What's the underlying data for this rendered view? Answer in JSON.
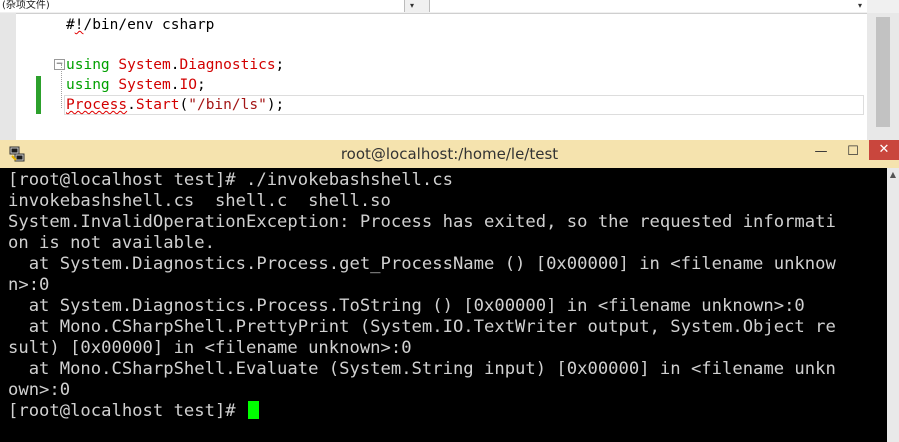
{
  "editor": {
    "nav_left_label": "(杂项文件)",
    "code_lines": [
      {
        "parts": [
          {
            "t": "#",
            "c": ""
          },
          {
            "t": "!",
            "c": "squiggle"
          },
          {
            "t": "/bin/env csharp",
            "c": ""
          }
        ]
      },
      {
        "parts": []
      },
      {
        "parts": [
          {
            "t": "using",
            "c": "kw"
          },
          {
            "t": " ",
            "c": ""
          },
          {
            "t": "System",
            "c": "ns"
          },
          {
            "t": ".",
            "c": ""
          },
          {
            "t": "Diagnostics",
            "c": "ns"
          },
          {
            "t": ";",
            "c": ""
          }
        ]
      },
      {
        "parts": [
          {
            "t": "using",
            "c": "kw"
          },
          {
            "t": " ",
            "c": ""
          },
          {
            "t": "System",
            "c": "ns"
          },
          {
            "t": ".",
            "c": ""
          },
          {
            "t": "IO",
            "c": "ns"
          },
          {
            "t": ";",
            "c": ""
          }
        ]
      },
      {
        "parts": [
          {
            "t": "Process",
            "c": "ns squiggle"
          },
          {
            "t": ".",
            "c": ""
          },
          {
            "t": "Start",
            "c": "ns"
          },
          {
            "t": "(",
            "c": ""
          },
          {
            "t": "\"/bin/ls\"",
            "c": "str"
          },
          {
            "t": ");",
            "c": ""
          }
        ]
      }
    ]
  },
  "terminal": {
    "title": "root@localhost:/home/le/test",
    "minimize_glyph": "—",
    "maximize_glyph": "☐",
    "close_glyph": "✕",
    "lines": [
      "[root@localhost test]# ./invokebashshell.cs",
      "invokebashshell.cs  shell.c  shell.so",
      "System.InvalidOperationException: Process has exited, so the requested informati",
      "on is not available.",
      "  at System.Diagnostics.Process.get_ProcessName () [0x00000] in <filename unknow",
      "n>:0",
      "  at System.Diagnostics.Process.ToString () [0x00000] in <filename unknown>:0",
      "  at Mono.CSharpShell.PrettyPrint (System.IO.TextWriter output, System.Object re",
      "sult) [0x00000] in <filename unknown>:0",
      "  at Mono.CSharpShell.Evaluate (System.String input) [0x00000] in <filename unkn",
      "own>:0"
    ],
    "prompt": "[root@localhost test]# "
  }
}
